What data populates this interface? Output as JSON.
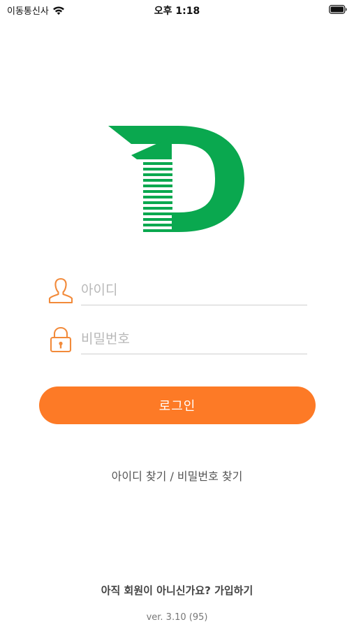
{
  "status_bar": {
    "carrier": "이동통신사",
    "time": "오후 1:18"
  },
  "icons": {
    "wifi": "wifi-icon",
    "battery": "battery-icon",
    "user": "user-icon",
    "lock": "lock-icon",
    "logo": "app-logo-d"
  },
  "colors": {
    "brand_green": "#0aa84f",
    "accent_orange": "#fd7a26",
    "button_text": "#ffffff"
  },
  "login_form": {
    "id_placeholder": "아이디",
    "id_value": "",
    "password_placeholder": "비밀번호",
    "password_value": "",
    "login_label": "로그인"
  },
  "links": {
    "find_account": "아이디 찾기 / 비밀번호 찾기",
    "signup": "아직 회원이 아니신가요? 가입하기"
  },
  "footer": {
    "version": "ver. 3.10 (95)"
  }
}
